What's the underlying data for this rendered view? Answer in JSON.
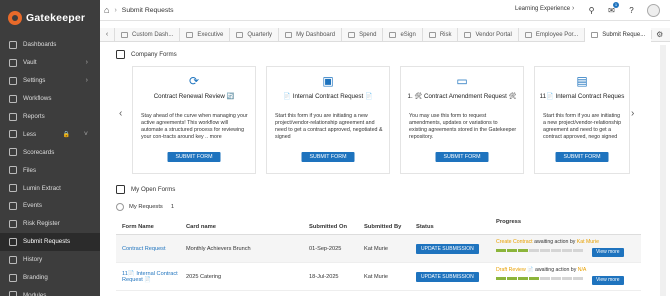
{
  "app": {
    "name": "Gatekeeper"
  },
  "sidebar": {
    "items": [
      {
        "label": "Dashboards",
        "icon": "dashboard-icon"
      },
      {
        "label": "Vault",
        "icon": "vault-icon",
        "chevron": true
      },
      {
        "label": "Settings",
        "icon": "gear-icon",
        "chevron": true
      },
      {
        "label": "Workflows",
        "icon": "workflow-icon"
      },
      {
        "label": "Reports",
        "icon": "report-icon"
      },
      {
        "label": "Less",
        "icon": "more-icon"
      },
      {
        "label": "Scorecards",
        "icon": "scorecard-icon"
      },
      {
        "label": "Files",
        "icon": "file-icon"
      },
      {
        "label": "Lumin Extract",
        "icon": "extract-icon"
      },
      {
        "label": "Events",
        "icon": "calendar-icon"
      },
      {
        "label": "Risk Register",
        "icon": "risk-icon"
      },
      {
        "label": "Submit Requests",
        "icon": "request-icon",
        "active": true
      },
      {
        "label": "History",
        "icon": "history-icon"
      },
      {
        "label": "Branding",
        "icon": "branding-icon"
      },
      {
        "label": "Modules",
        "icon": "modules-icon"
      }
    ]
  },
  "header": {
    "breadcrumb": "Submit Requests",
    "workspace": "Learning Experience",
    "notification_count": "1"
  },
  "tabs": [
    {
      "label": "Custom Dash..."
    },
    {
      "label": "Executive"
    },
    {
      "label": "Quarterly"
    },
    {
      "label": "My Dashboard"
    },
    {
      "label": "Spend"
    },
    {
      "label": "eSign"
    },
    {
      "label": "Risk"
    },
    {
      "label": "Vendor Portal"
    },
    {
      "label": "Employee Por..."
    },
    {
      "label": "Submit Reque...",
      "active": true
    }
  ],
  "company_forms": {
    "heading": "Company Forms",
    "cards": [
      {
        "icon": "⟳",
        "title": "Contract Renewal Review 🔄",
        "description": "Stay ahead of the curve when managing your active agreements! This workflow will automate a structured process for reviewing your con-tracts around key .. more",
        "button": "SUBMIT FORM"
      },
      {
        "icon": "▣",
        "title": "📄 Internal Contract Request 📄",
        "description": "Start this form if you are initiating a new project/vendor-relationship agreement and need to get a contract approved, negotiated & signed",
        "button": "SUBMIT FORM"
      },
      {
        "icon": "▭",
        "title": "1. 🛠 Contract Amendment Request 🛠",
        "description": "You may use this form to request amendments, updates or variations to existing agreements stored in the Gatekeeper repository.",
        "button": "SUBMIT FORM"
      },
      {
        "icon": "▤",
        "title": "11📄 Internal Contract Reques",
        "description": "Start this form if you are initiating a new project/vendor-relationship agreement and need to get a contract approved, nego signed",
        "button": "SUBMIT FORM"
      }
    ]
  },
  "open_forms": {
    "heading": "My Open Forms",
    "tab_label": "My Requests",
    "tab_count": "1",
    "columns": [
      "Form Name",
      "Card name",
      "Submitted On",
      "Submitted By",
      "Status",
      "Progress"
    ],
    "rows": [
      {
        "form_name": "Contract Request",
        "card_name": "Monthly Achievers Brunch",
        "submitted_on": "01-Sep-2025",
        "submitted_by": "Kat Murie",
        "status_button": "UPDATE SUBMISSION",
        "progress_stage": "Create Contract",
        "progress_mid": " awaiting action by ",
        "progress_user": "Kat Murie",
        "progress_done": 3,
        "progress_total": 8,
        "view_button": "View more"
      },
      {
        "form_name": "11📄 Internal Contract Request 📄",
        "card_name": "2025 Catering",
        "submitted_on": "18-Jul-2025",
        "submitted_by": "Kat Murie",
        "status_button": "UPDATE SUBMISSION",
        "progress_stage": "Draft Review",
        "progress_mid": " 📄 awaiting action by ",
        "progress_user": "N/A",
        "progress_done": 4,
        "progress_total": 8,
        "view_button": "View more"
      }
    ]
  },
  "colors": {
    "accent": "#1e73be",
    "sidebar": "#3d3d3d",
    "progress_done": "#8cb53b",
    "highlight": "#e8a000"
  }
}
